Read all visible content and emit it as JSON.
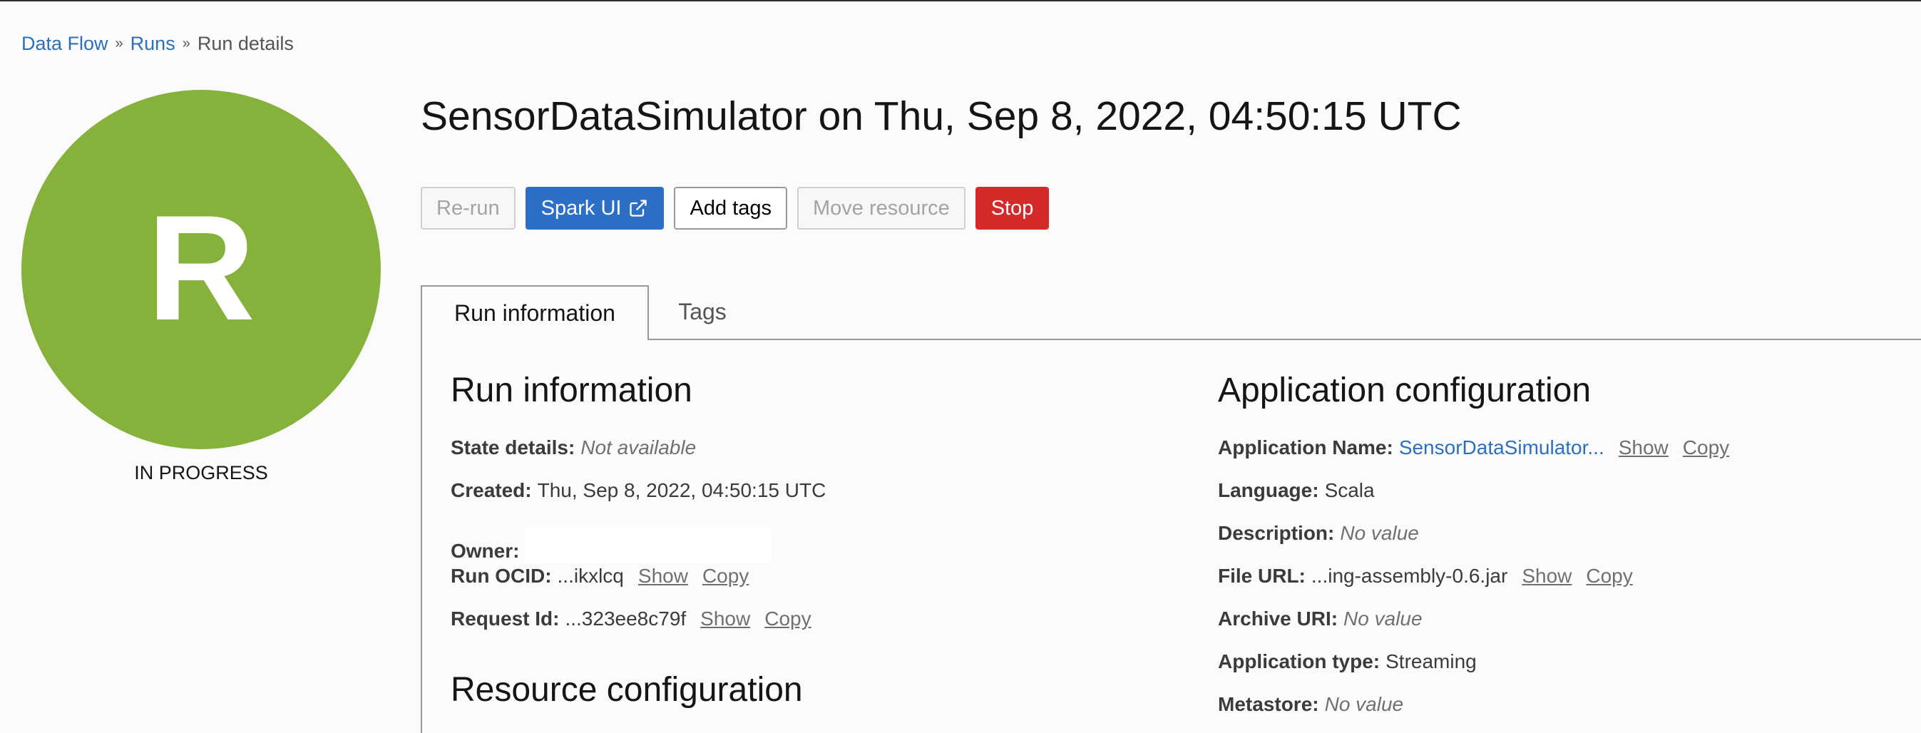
{
  "breadcrumb": {
    "items": [
      "Data Flow",
      "Runs"
    ],
    "current": "Run details",
    "separator": "»"
  },
  "avatar": {
    "letter": "R",
    "status": "IN PROGRESS",
    "color": "#86b23c"
  },
  "title": "SensorDataSimulator on Thu, Sep 8, 2022, 04:50:15 UTC",
  "buttons": {
    "rerun": "Re-run",
    "spark_ui": "Spark UI",
    "add_tags": "Add tags",
    "move_resource": "Move resource",
    "stop": "Stop"
  },
  "tabs": {
    "active": "Run information",
    "other": "Tags"
  },
  "run_info": {
    "title": "Run information",
    "fields": [
      {
        "label": "State details:",
        "value": "Not available"
      },
      {
        "label": "Created:",
        "value": "Thu, Sep 8, 2022, 04:50:15 UTC"
      },
      {
        "label": "Owner:",
        "value": ""
      },
      {
        "label": "Run OCID:",
        "value": "...ikxlcq",
        "show": "Show",
        "copy": "Copy"
      },
      {
        "label": "Request Id:",
        "value": "...323ee8c79f",
        "show": "Show",
        "copy": "Copy"
      }
    ]
  },
  "resource_config": {
    "title": "Resource configuration"
  },
  "app_config": {
    "title": "Application configuration",
    "fields": [
      {
        "label": "Application Name:",
        "value": "SensorDataSimulator...",
        "show": "Show",
        "copy": "Copy"
      },
      {
        "label": "Language:",
        "value": "Scala"
      },
      {
        "label": "Description:",
        "value": "No value"
      },
      {
        "label": "File URL:",
        "value": "...ing-assembly-0.6.jar",
        "show": "Show",
        "copy": "Copy"
      },
      {
        "label": "Archive URI:",
        "value": "No value"
      },
      {
        "label": "Application type:",
        "value": "Streaming"
      },
      {
        "label": "Metastore:",
        "value": "No value"
      }
    ]
  },
  "colors": {
    "link": "#2c6fbf",
    "primary": "#2b6fc6",
    "danger": "#d52a2a"
  },
  "icons": {
    "external_link": "external-link-icon"
  }
}
